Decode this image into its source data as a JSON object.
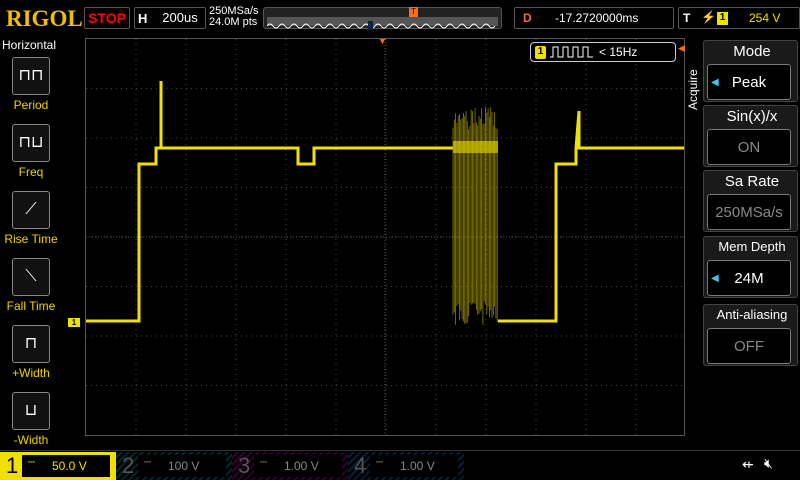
{
  "header": {
    "logo": "RIGOL",
    "run_state": "STOP",
    "h_label": "H",
    "timebase": "200us",
    "sample_rate": "250MSa/s",
    "mem_points": "24.0M pts",
    "d_label": "D",
    "delay": "-17.2720000ms",
    "t_label": "T",
    "trigger_channel": "1",
    "trigger_level": "254 V",
    "trigger_marker": "T"
  },
  "left_menu": {
    "title": "Horizontal",
    "items": [
      {
        "label": "Period",
        "icon": "period-icon"
      },
      {
        "label": "Freq",
        "icon": "freq-icon"
      },
      {
        "label": "Rise Time",
        "icon": "rise-time-icon"
      },
      {
        "label": "Fall Time",
        "icon": "fall-time-icon"
      },
      {
        "label": "+Width",
        "icon": "pos-width-icon"
      },
      {
        "label": "-Width",
        "icon": "neg-width-icon"
      }
    ]
  },
  "measurement": {
    "channel": "1",
    "label": "< 15Hz"
  },
  "right_menu": {
    "side_label": "Acquire",
    "items": [
      {
        "title": "Mode",
        "value": "Peak"
      },
      {
        "title": "Sin(x)/x",
        "value": "ON"
      },
      {
        "title": "Sa Rate",
        "value": "250MSa/s"
      },
      {
        "title": "Mem Depth",
        "value": "24M"
      },
      {
        "title": "Anti-aliasing",
        "value": "OFF"
      }
    ]
  },
  "channels": [
    {
      "num": "1",
      "scale": "50.0 V",
      "color": "#f0e000"
    },
    {
      "num": "2",
      "scale": "100 V",
      "color": "#00a0a0"
    },
    {
      "num": "3",
      "scale": "1.00 V",
      "color": "#c000c0"
    },
    {
      "num": "4",
      "scale": "1.00 V",
      "color": "#2070d0"
    }
  ],
  "ground_marker": "1"
}
